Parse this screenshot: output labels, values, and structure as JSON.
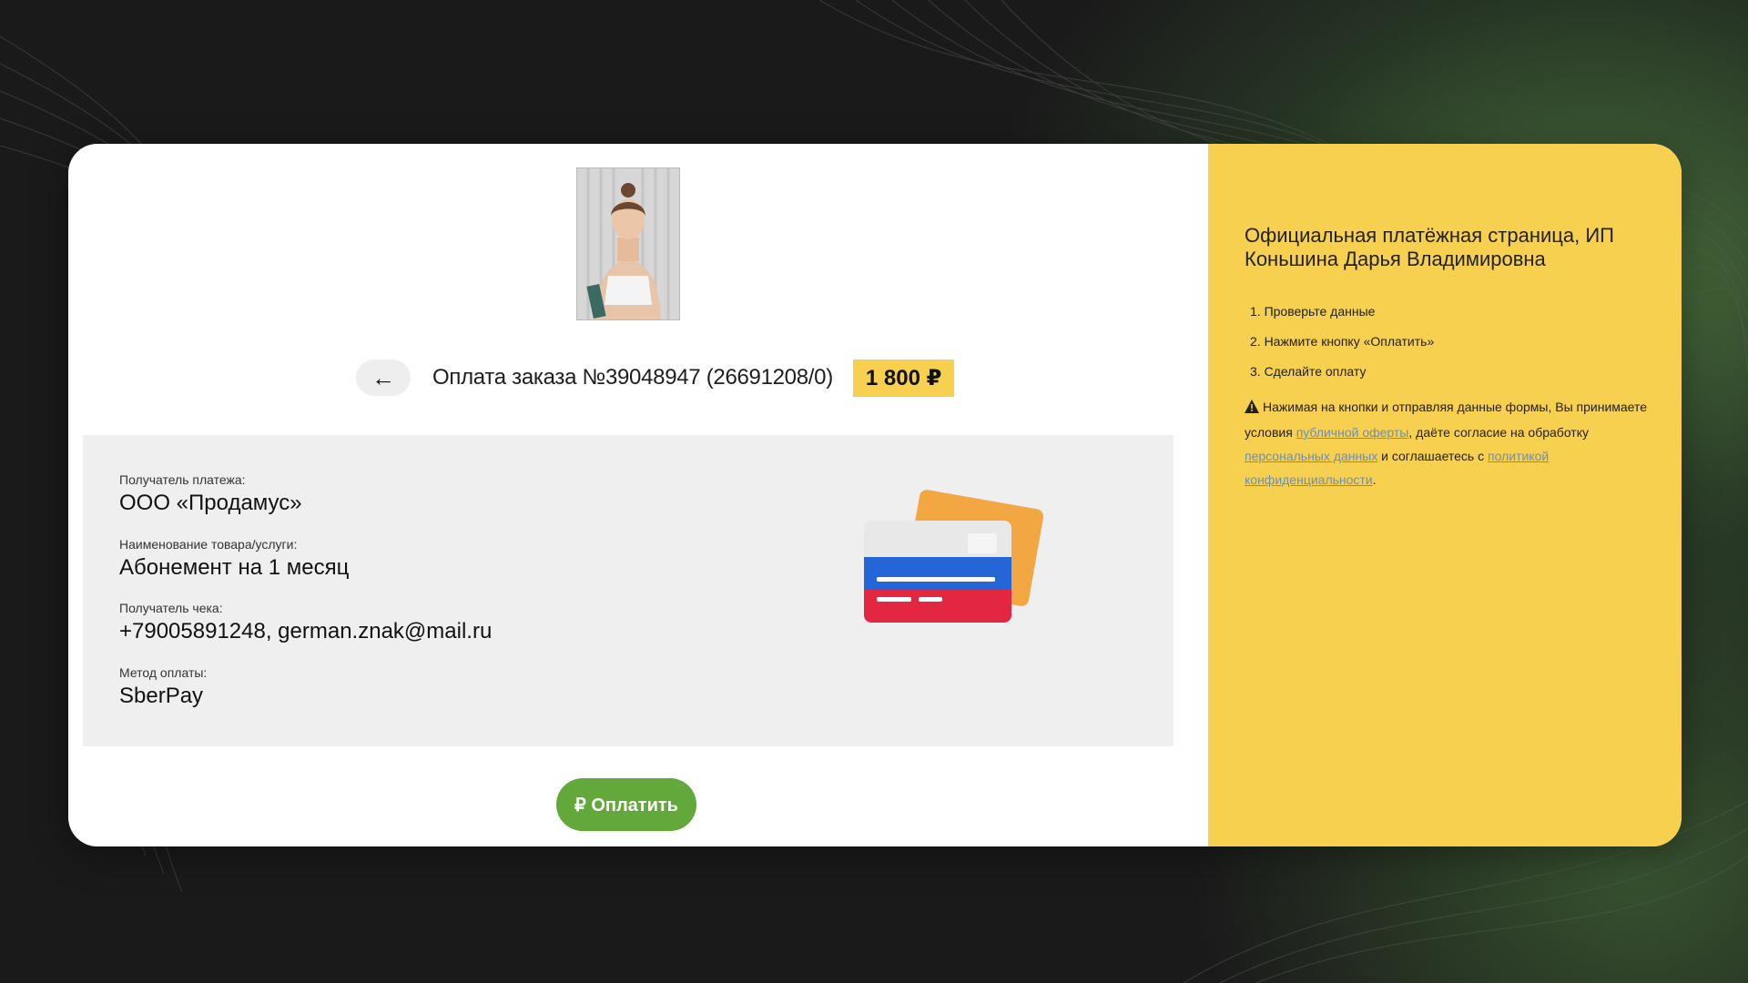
{
  "order": {
    "back_arrow": "←",
    "title": "Оплата заказа №39048947 (26691208/0)",
    "price": "1 800 ₽"
  },
  "details": {
    "recipient_label": "Получатель платежа:",
    "recipient_value": "ООО «Продамус»",
    "product_label": "Наименование товара/услуги:",
    "product_value": "Абонемент на 1 месяц",
    "receipt_label": "Получатель чека:",
    "receipt_value": "+79005891248, german.znak@mail.ru",
    "method_label": "Метод оплаты:",
    "method_value": "SberPay"
  },
  "pay_button": {
    "label": "₽ Оплатить"
  },
  "sidebar": {
    "title": "Официальная платёжная страница, ИП Коньшина Дарья Владимировна",
    "steps": [
      "1. Проверьте данные",
      "2. Нажмите кнопку «Оплатить»",
      "3. Сделайте оплату"
    ],
    "notice_text_1": "Нажимая на кнопки и отправляя данные формы, Вы принимаете условия",
    "offer_link": "публичной оферты",
    "notice_text_2": ", даёте согласие на обработку",
    "personal_data_link": "персональных данных",
    "notice_text_3": "и соглашаетесь с",
    "privacy_link": "политикой конфиденциальности",
    "notice_text_4": "."
  },
  "icons": {
    "back": "arrow-left-icon",
    "warning": "warning-icon",
    "cards": "bank-cards-icon"
  },
  "colors": {
    "accent_yellow": "#f7d04f",
    "pay_green": "#62a83a",
    "link_blue": "#6b8fb9",
    "info_bg": "#efefef"
  }
}
